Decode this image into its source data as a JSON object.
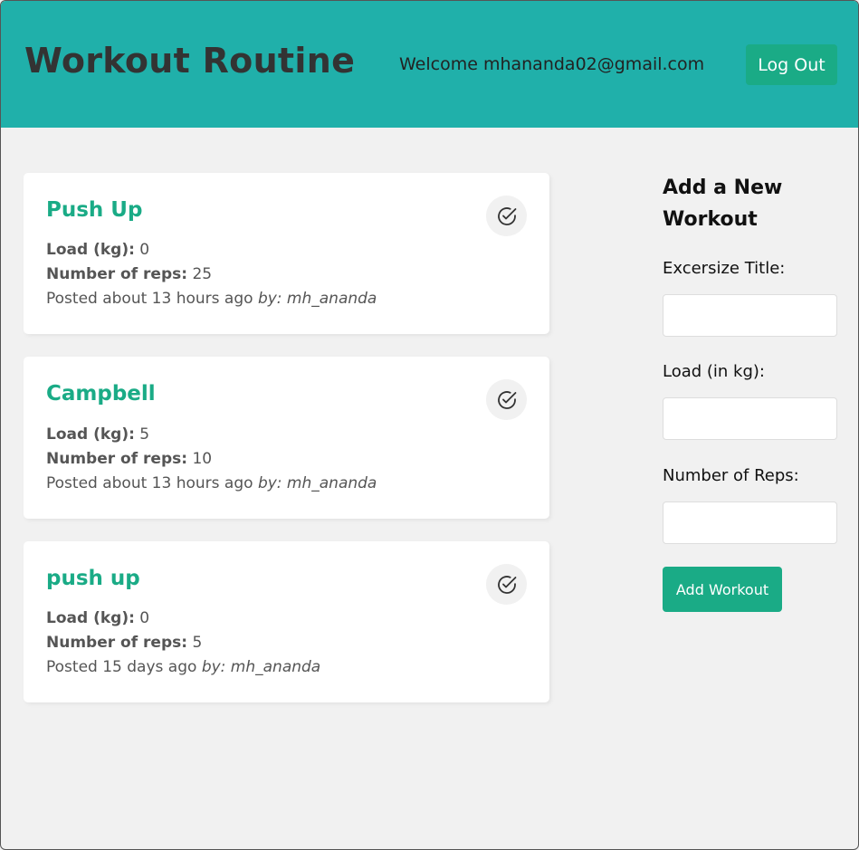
{
  "header": {
    "title": "Workout Routine",
    "welcome": "Welcome mhananda02@gmail.com",
    "logout_label": "Log Out"
  },
  "workouts": [
    {
      "title": "Push Up",
      "load_label": "Load (kg):",
      "load": "0",
      "reps_label": "Number of reps:",
      "reps": "25",
      "posted": "Posted about 13 hours ago",
      "by": "by: mh_ananda",
      "icon": "check-circle-icon"
    },
    {
      "title": "Campbell",
      "load_label": "Load (kg):",
      "load": "5",
      "reps_label": "Number of reps:",
      "reps": "10",
      "posted": "Posted about 13 hours ago",
      "by": "by: mh_ananda",
      "icon": "check-circle-icon"
    },
    {
      "title": "push up",
      "load_label": "Load (kg):",
      "load": "0",
      "reps_label": "Number of reps:",
      "reps": "5",
      "posted": "Posted 15 days ago",
      "by": "by: mh_ananda",
      "icon": "check-circle-icon"
    }
  ],
  "form": {
    "title": "Add a New Workout",
    "title_label": "Excersize Title:",
    "title_value": "",
    "load_label": "Load (in kg):",
    "load_value": "",
    "reps_label": "Number of Reps:",
    "reps_value": "",
    "submit_label": "Add Workout"
  },
  "colors": {
    "header_bg": "#20b0aa",
    "accent": "#1aab86",
    "page_bg": "#f1f1f1"
  }
}
